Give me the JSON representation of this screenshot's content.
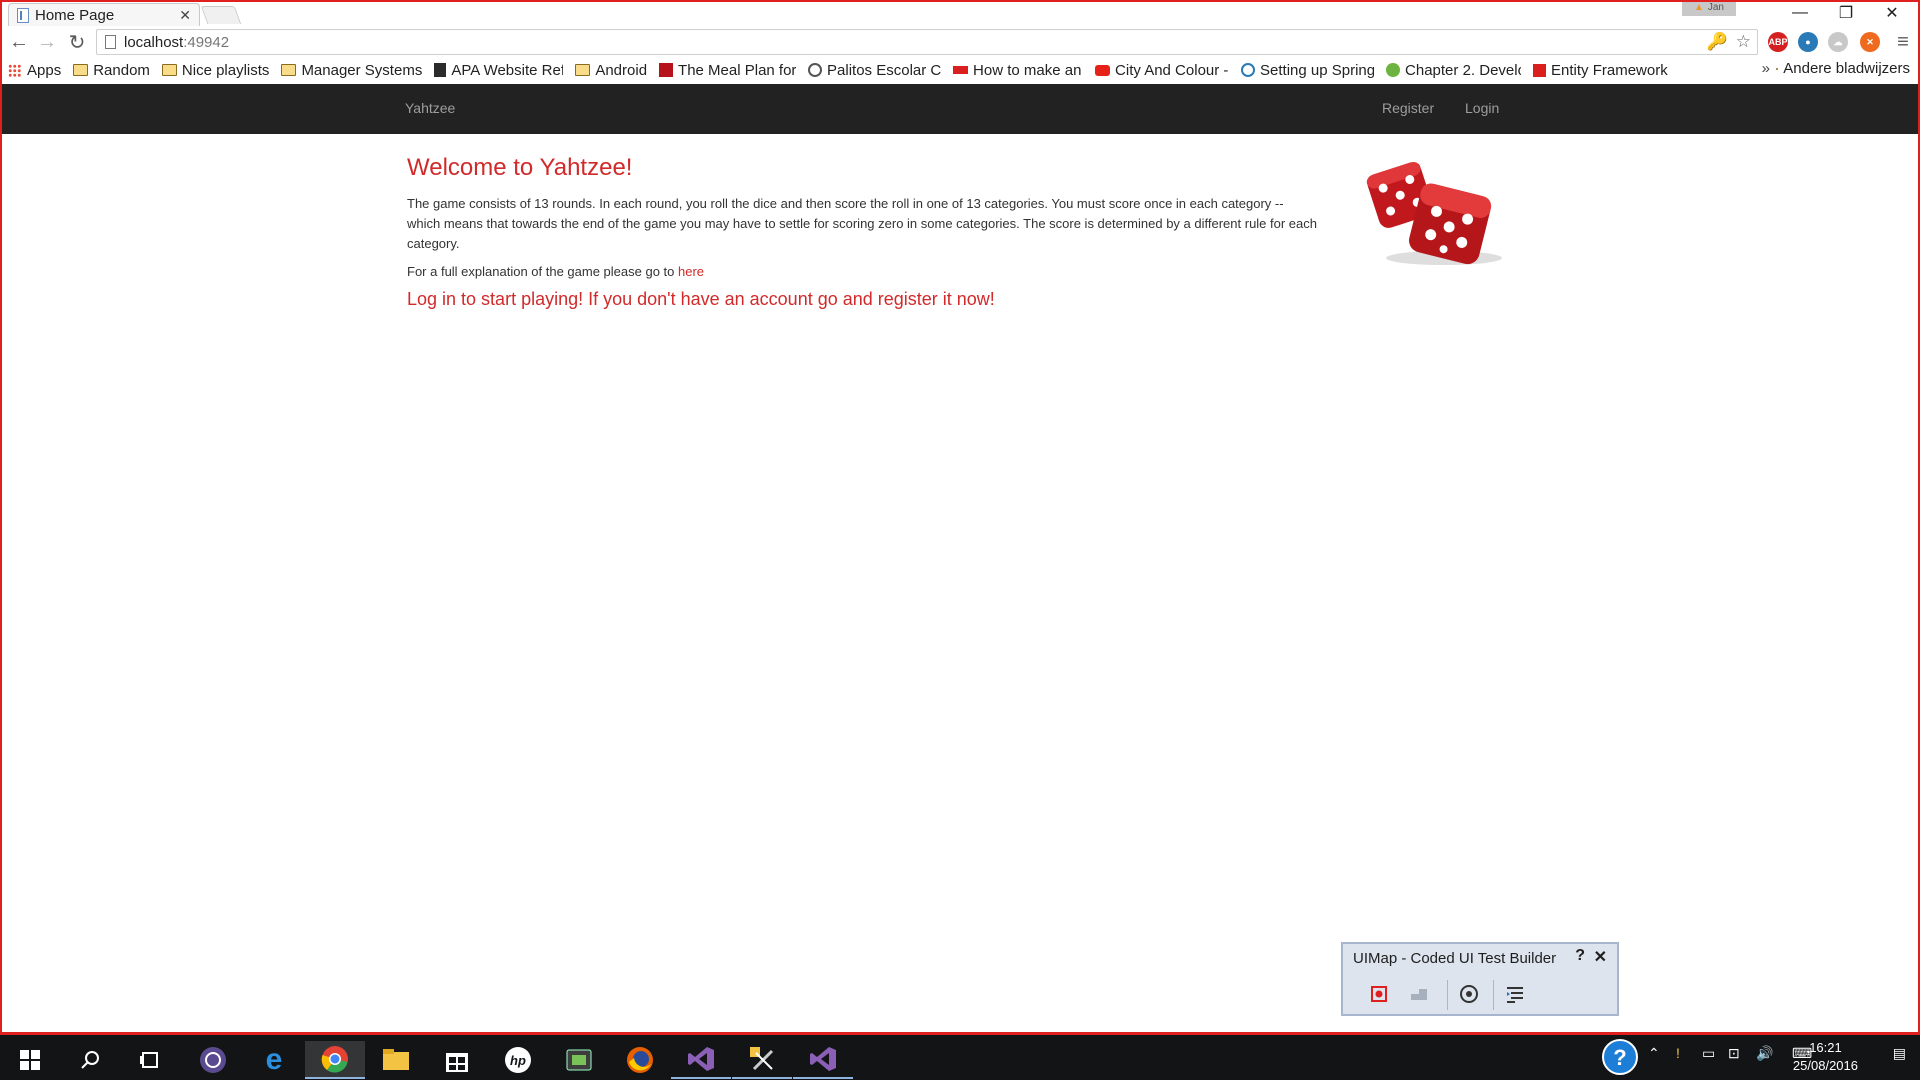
{
  "browser": {
    "tab_title": "Home Page",
    "tab_close": "✕",
    "user_badge": "Jan",
    "window_buttons": {
      "minimize": "—",
      "restore": "❐",
      "close": "✕"
    },
    "url_host": "localhost",
    "url_port": ":49942",
    "bookmarks": [
      {
        "label": "Apps",
        "icon": "apps-grid-icon"
      },
      {
        "label": "Random",
        "icon": "folder-icon"
      },
      {
        "label": "Nice playlists",
        "icon": "folder-icon"
      },
      {
        "label": "Manager Systems",
        "icon": "folder-icon"
      },
      {
        "label": "APA Website Refe",
        "icon": "apa-icon"
      },
      {
        "label": "Android",
        "icon": "folder-icon"
      },
      {
        "label": "The Meal Plan for",
        "icon": "mealplan-icon"
      },
      {
        "label": "Palitos Escolar Co",
        "icon": "palitos-icon"
      },
      {
        "label": "How to make an",
        "icon": "stn-icon"
      },
      {
        "label": "City And Colour -",
        "icon": "youtube-icon"
      },
      {
        "label": "Setting up Spring",
        "icon": "wordpress-icon"
      },
      {
        "label": "Chapter 2. Develo",
        "icon": "spring-icon"
      },
      {
        "label": "Entity Framework",
        "icon": "dotnet-icon"
      }
    ],
    "bookmarks_overflow": "»",
    "other_bookmarks": "Andere bladwijzers"
  },
  "site": {
    "brand": "Yahtzee",
    "nav": {
      "register": "Register",
      "login": "Login"
    },
    "heading": "Welcome to Yahtzee!",
    "intro": "The game consists of 13 rounds. In each round, you roll the dice and then score the roll in one of 13 categories. You must score once in each category -- which means that towards the end of the game you may have to settle for scoring zero in some categories. The score is determined by a different rule for each category.",
    "explain_prefix": "For a full explanation of the game please go to ",
    "explain_link": "here",
    "cta": "Log in to start playing! If you don't have an account go and register it now!"
  },
  "test_builder": {
    "title": "UIMap - Coded UI Test Builder",
    "help": "?",
    "close": "✕"
  },
  "taskbar": {
    "time": "16:21",
    "date": "25/08/2016"
  },
  "colors": {
    "accent_red": "#d12a2a",
    "navbar": "#222222",
    "frame_border": "#e0201f"
  }
}
